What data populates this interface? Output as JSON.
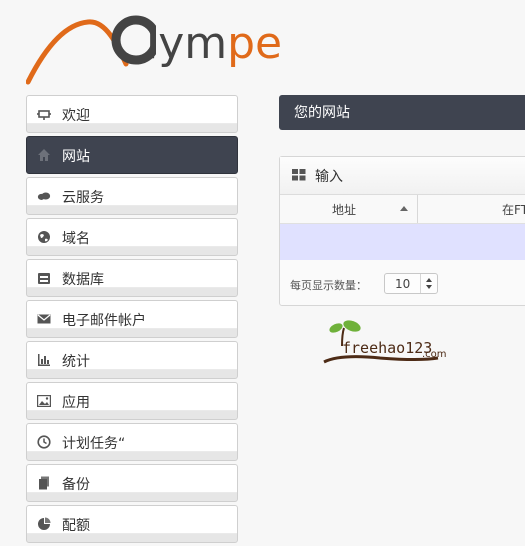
{
  "logo": {
    "text_main": "lym",
    "text_accent": "pe"
  },
  "sidebar": {
    "items": [
      {
        "label": "欢迎",
        "icon": "monitor-icon"
      },
      {
        "label": "网站",
        "icon": "home-icon",
        "active": true
      },
      {
        "label": "云服务",
        "icon": "cloud-icon"
      },
      {
        "label": "域名",
        "icon": "globe-icon"
      },
      {
        "label": "数据库",
        "icon": "database-icon"
      },
      {
        "label": "电子邮件帐户",
        "icon": "mail-icon"
      },
      {
        "label": "统计",
        "icon": "bar-chart-icon"
      },
      {
        "label": "应用",
        "icon": "image-icon"
      },
      {
        "label": "计划任务“",
        "icon": "clock-icon"
      },
      {
        "label": "备份",
        "icon": "copy-icon"
      },
      {
        "label": "配额",
        "icon": "pie-chart-icon"
      }
    ]
  },
  "main": {
    "title": "您的网站",
    "panel": {
      "title": "输入",
      "columns": [
        "地址",
        "在FT"
      ],
      "per_page_label": "每页显示数量：",
      "per_page_value": "10"
    }
  },
  "watermark": {
    "text": "freehao123",
    "suffix": ".com"
  }
}
